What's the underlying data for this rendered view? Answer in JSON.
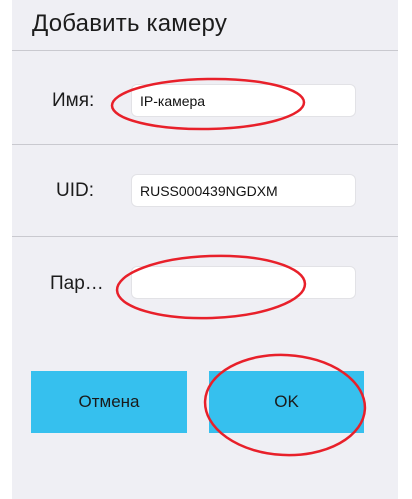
{
  "dialog": {
    "title": "Добавить камеру",
    "background": "#efeff4"
  },
  "fields": {
    "name": {
      "label": "Имя:",
      "value": "IP-камера"
    },
    "uid": {
      "label": "UID:",
      "value": "RUSS000439NGDXM"
    },
    "password": {
      "label": "Пар…",
      "value": ""
    }
  },
  "buttons": {
    "cancel_label": "Отмена",
    "ok_label": "OK",
    "color": "#36c0ee"
  },
  "annotations": {
    "highlight_color": "#e8202a",
    "shape": "hand-drawn-ellipse"
  }
}
